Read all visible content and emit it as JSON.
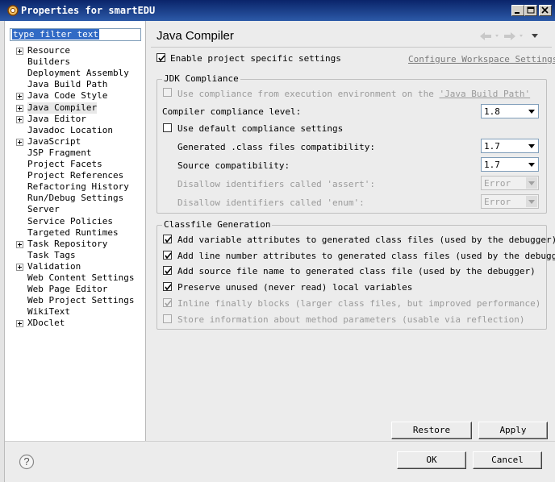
{
  "window": {
    "title": "Properties for smartEDU"
  },
  "filter": {
    "value": "type filter text"
  },
  "tree": [
    {
      "label": "Resource",
      "expandable": true
    },
    {
      "label": "Builders",
      "expandable": false
    },
    {
      "label": "Deployment Assembly",
      "expandable": false
    },
    {
      "label": "Java Build Path",
      "expandable": false
    },
    {
      "label": "Java Code Style",
      "expandable": true
    },
    {
      "label": "Java Compiler",
      "expandable": true,
      "selected": true
    },
    {
      "label": "Java Editor",
      "expandable": true
    },
    {
      "label": "Javadoc Location",
      "expandable": false
    },
    {
      "label": "JavaScript",
      "expandable": true
    },
    {
      "label": "JSP Fragment",
      "expandable": false
    },
    {
      "label": "Project Facets",
      "expandable": false
    },
    {
      "label": "Project References",
      "expandable": false
    },
    {
      "label": "Refactoring History",
      "expandable": false
    },
    {
      "label": "Run/Debug Settings",
      "expandable": false
    },
    {
      "label": "Server",
      "expandable": false
    },
    {
      "label": "Service Policies",
      "expandable": false
    },
    {
      "label": "Targeted Runtimes",
      "expandable": false
    },
    {
      "label": "Task Repository",
      "expandable": true
    },
    {
      "label": "Task Tags",
      "expandable": false
    },
    {
      "label": "Validation",
      "expandable": true
    },
    {
      "label": "Web Content Settings",
      "expandable": false
    },
    {
      "label": "Web Page Editor",
      "expandable": false
    },
    {
      "label": "Web Project Settings",
      "expandable": false
    },
    {
      "label": "WikiText",
      "expandable": false
    },
    {
      "label": "XDoclet",
      "expandable": true
    }
  ],
  "page": {
    "title": "Java Compiler",
    "enable_specific": {
      "label": "Enable project specific settings",
      "checked": true
    },
    "configure_link": "Configure Workspace Settings..."
  },
  "jdk": {
    "group_label": "JDK Compliance",
    "use_compliance": {
      "label_pre": "Use compliance from execution environment on the ",
      "label_link": "'Java Build Path'",
      "checked": false,
      "disabled": true
    },
    "compliance_level": {
      "label": "Compiler compliance level:",
      "value": "1.8"
    },
    "use_default": {
      "label": "Use default compliance settings",
      "checked": false
    },
    "generated_class": {
      "label": "Generated .class files compatibility:",
      "value": "1.7"
    },
    "source_compat": {
      "label": "Source compatibility:",
      "value": "1.7"
    },
    "disallow_assert": {
      "label": "Disallow identifiers called 'assert':",
      "value": "Error",
      "disabled": true
    },
    "disallow_enum": {
      "label": "Disallow identifiers called 'enum':",
      "value": "Error",
      "disabled": true
    }
  },
  "classfile": {
    "group_label": "Classfile Generation",
    "items": [
      {
        "label": "Add variable attributes to generated class files (used by the debugger)",
        "checked": true,
        "disabled": false
      },
      {
        "label": "Add line number attributes to generated class files (used by the debugger)",
        "checked": true,
        "disabled": false
      },
      {
        "label": "Add source file name to generated class file (used by the debugger)",
        "checked": true,
        "disabled": false
      },
      {
        "label": "Preserve unused (never read) local variables",
        "checked": true,
        "disabled": false
      },
      {
        "label": "Inline finally blocks (larger class files, but improved performance)",
        "checked": true,
        "disabled": true
      },
      {
        "label": "Store information about method parameters (usable via reflection)",
        "checked": false,
        "disabled": true
      }
    ]
  },
  "buttons": {
    "restore_defaults": "Restore Defaults",
    "apply": "Apply",
    "ok": "OK",
    "cancel": "Cancel"
  },
  "help": {
    "icon": "help-icon",
    "glyph": "?"
  },
  "colors": {
    "titlebar": "#0a246a",
    "selection": "#316ac5"
  }
}
